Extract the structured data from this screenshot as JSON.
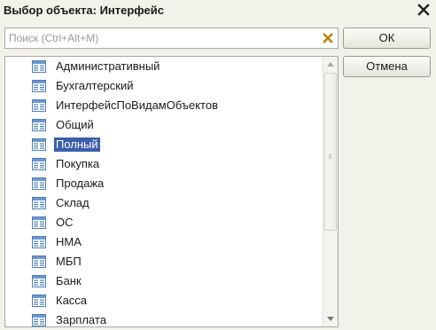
{
  "window": {
    "title": "Выбор объекта: Интерфейс"
  },
  "search": {
    "placeholder": "Поиск (Ctrl+Alt+M)",
    "value": ""
  },
  "buttons": {
    "ok_label": "ОК",
    "cancel_label": "Отмена"
  },
  "list": {
    "selected_index": 4,
    "items": [
      {
        "label": "Административный",
        "icon": "interface-icon"
      },
      {
        "label": "Бухгалтерский",
        "icon": "interface-icon"
      },
      {
        "label": "ИнтерфейсПоВидамОбъектов",
        "icon": "interface-icon"
      },
      {
        "label": "Общий",
        "icon": "interface-icon"
      },
      {
        "label": "Полный",
        "icon": "interface-icon"
      },
      {
        "label": "Покупка",
        "icon": "interface-icon"
      },
      {
        "label": "Продажа",
        "icon": "interface-icon"
      },
      {
        "label": "Склад",
        "icon": "interface-icon"
      },
      {
        "label": "ОС",
        "icon": "interface-icon"
      },
      {
        "label": "НМА",
        "icon": "interface-icon"
      },
      {
        "label": "МБП",
        "icon": "interface-icon"
      },
      {
        "label": "Банк",
        "icon": "interface-icon"
      },
      {
        "label": "Касса",
        "icon": "interface-icon"
      },
      {
        "label": "Зарплата",
        "icon": "interface-icon"
      }
    ]
  },
  "colors": {
    "background": "#f2f1ea",
    "selection": "#3b5fae",
    "clear_icon": "#b8860b"
  }
}
